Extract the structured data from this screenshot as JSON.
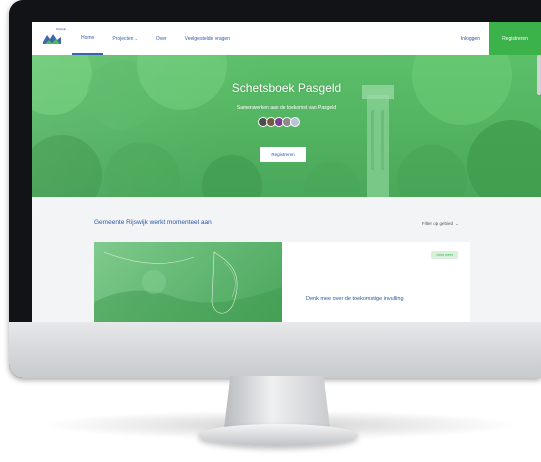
{
  "nav": {
    "logo_text": "Rijswijk",
    "items": [
      {
        "label": "Home",
        "active": true
      },
      {
        "label": "Projecten",
        "has_dropdown": true
      },
      {
        "label": "Over"
      },
      {
        "label": "Veelgestelde vragen"
      }
    ],
    "login_label": "Inloggen",
    "register_label": "Registreren"
  },
  "hero": {
    "title": "Schetsboek Pasgeld",
    "subtitle": "Samenwerken aan de toekomst van Pasgeld",
    "button_label": "Registreren",
    "avatar_colors": [
      "#4b4b4b",
      "#6f5b3e",
      "#7a3f8e",
      "#8a8a8a",
      "#b8c4d6"
    ]
  },
  "content": {
    "section_title": "Gemeente Rijswijk werkt momenteel aan",
    "filter_label": "Filter op gebied",
    "card": {
      "badge": "Lees meer",
      "title": "Denk mee over de toekomstige invulling"
    }
  },
  "colors": {
    "brand_blue": "#2a56a8",
    "brand_green": "#3bb24a"
  }
}
